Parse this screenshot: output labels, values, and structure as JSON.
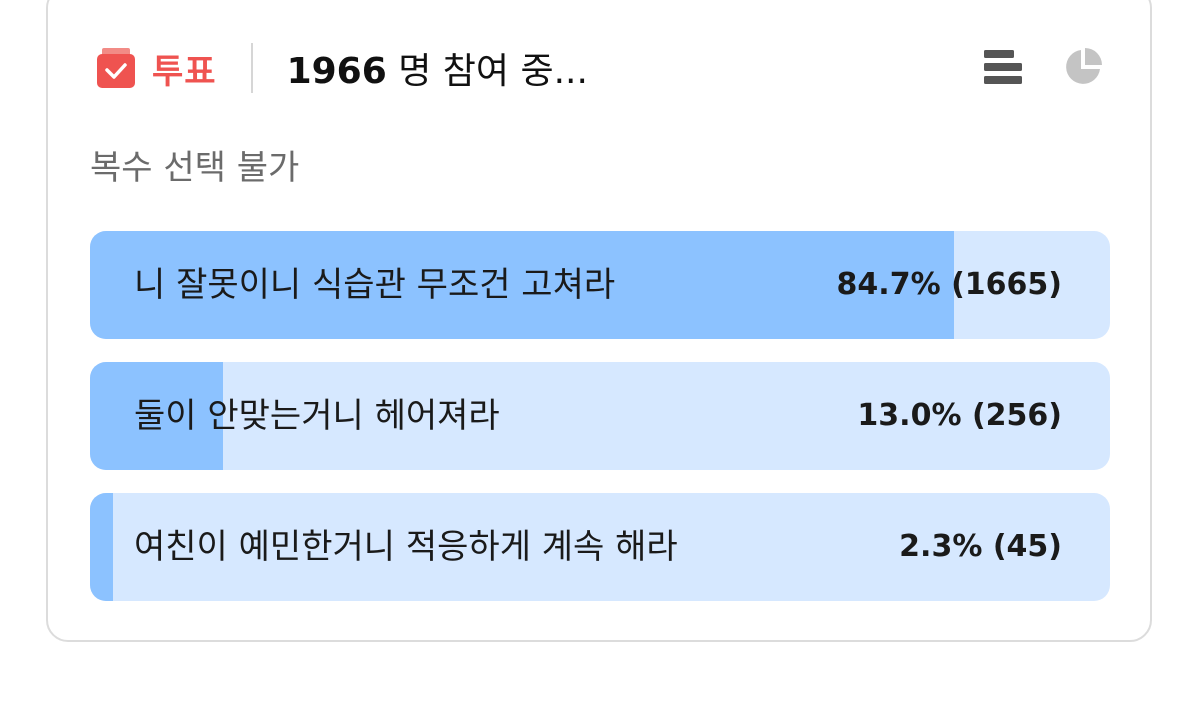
{
  "header": {
    "vote_label": "투표",
    "participant_count": "1966",
    "participant_suffix": "명 참여 중...",
    "icons": {
      "vote": "ballot-box-icon",
      "list_view": "bar-list-icon",
      "pie_view": "pie-chart-icon"
    }
  },
  "subtitle": "복수 선택 불가",
  "options": [
    {
      "label": "니 잘못이니 식습관 무조건 고쳐라",
      "result": "84.7% (1665)",
      "percent": 84.7
    },
    {
      "label": "둘이 안맞는거니 헤어져라",
      "result": "13.0% (256)",
      "percent": 13.0
    },
    {
      "label": "여친이 예민한거니 적응하게 계속 해라",
      "result": "2.3% (45)",
      "percent": 2.3
    }
  ],
  "colors": {
    "accent": "#ef5350",
    "bar_fill": "#8cc2ff",
    "bar_track": "#d6e8ff"
  }
}
